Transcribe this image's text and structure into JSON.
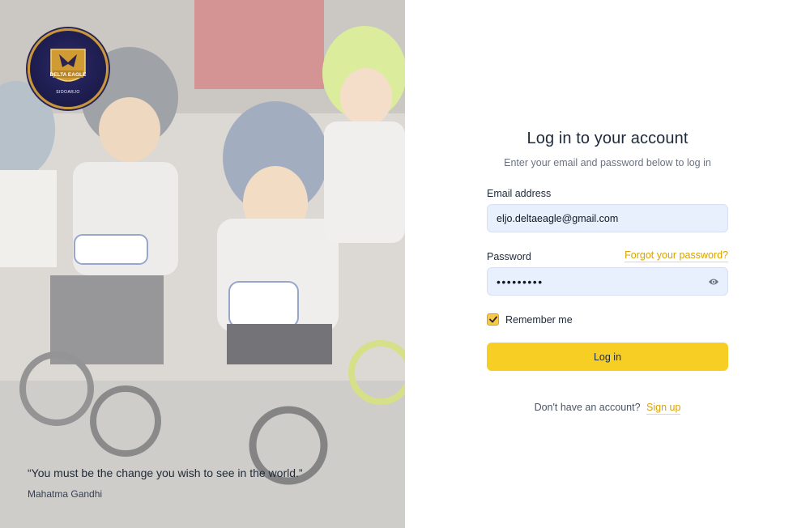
{
  "hero": {
    "image": "kids-balance-bike-race-photo",
    "logo": {
      "name": "delta-eagle-logo",
      "text": "DELTA EAGLE",
      "subtext": "SIDOARJO",
      "ring_color": "#c9973a"
    },
    "quote": "“You must be the change you wish to see in the world.”",
    "author": "Mahatma Gandhi"
  },
  "login": {
    "title": "Log in to your account",
    "subtitle": "Enter your email and password below to log in",
    "email_label": "Email address",
    "email_value": "eljo.deltaeagle@gmail.com",
    "password_label": "Password",
    "password_value": "•••••••••",
    "forgot_link": "Forgot your password?",
    "show_password_icon": "eye-icon",
    "remember_label": "Remember me",
    "remember_checked": true,
    "submit_label": "Log in",
    "signup_prompt": "Don't have an account?",
    "signup_link": "Sign up"
  },
  "colors": {
    "accent": "#f7ce24",
    "link": "#d9a300",
    "input_bg": "#e8effd",
    "title_text": "#1e293b"
  }
}
